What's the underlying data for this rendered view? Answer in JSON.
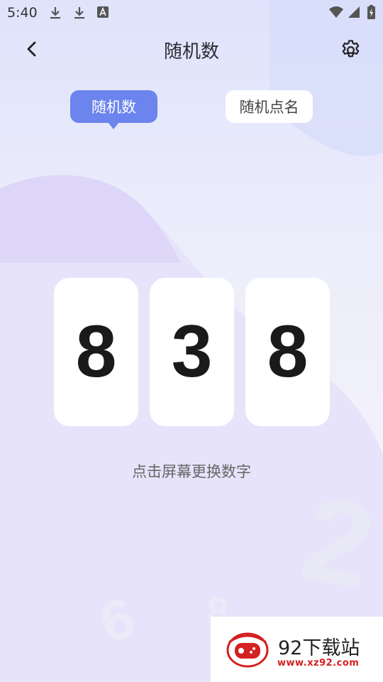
{
  "status_bar": {
    "time": "5:40"
  },
  "header": {
    "title": "随机数"
  },
  "tabs": [
    {
      "label": "随机数",
      "active": true
    },
    {
      "label": "随机点名",
      "active": false
    }
  ],
  "digits": [
    "8",
    "3",
    "8"
  ],
  "hint": "点击屏幕更换数字",
  "watermark": {
    "brand": "92下载站",
    "url": "www.xz92.com"
  },
  "colors": {
    "accent": "#6c84ee",
    "text_dark": "#2b2b33",
    "hint": "#666666"
  }
}
